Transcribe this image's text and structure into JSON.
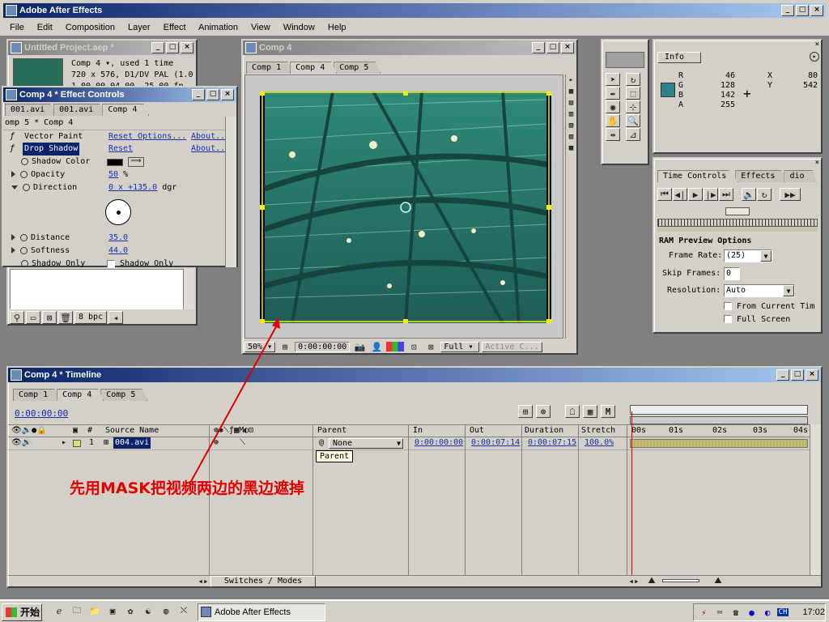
{
  "app": {
    "title": "Adobe After Effects"
  },
  "menu": [
    "File",
    "Edit",
    "Composition",
    "Layer",
    "Effect",
    "Animation",
    "View",
    "Window",
    "Help"
  ],
  "project": {
    "title": "Untitled Project.aep *",
    "info_lines": [
      "Comp 4 ▾, used 1 time",
      "720 x 576, D1/DV PAL (1.0",
      "1 00 00 04 00, 25.00 fp"
    ],
    "bpc": "8 bpc"
  },
  "effect_controls": {
    "title": "Comp 4 * Effect Controls",
    "tabs": [
      "001.avi",
      "001.avi",
      "Comp 4"
    ],
    "header": "omp 5 * Comp 4",
    "rows": [
      {
        "name": "Vector Paint",
        "reset": "Reset Options...",
        "about": "About..."
      },
      {
        "name": "Drop Shadow",
        "reset": "Reset",
        "about": "About..."
      }
    ],
    "props": {
      "shadow_color": "Shadow Color",
      "opacity": "Opacity",
      "opacity_val": "50",
      "opacity_unit": "%",
      "direction": "Direction",
      "direction_val": "0 x +135.0",
      "direction_unit": "dgr",
      "distance": "Distance",
      "distance_val": "35.0",
      "softness": "Softness",
      "softness_val": "44.0",
      "shadow_only": "Shadow Only",
      "shadow_only_box": "Shadow Only"
    }
  },
  "comp_window": {
    "title": "Comp 4",
    "tabs": [
      "Comp 1",
      "Comp 4",
      "Comp 5"
    ],
    "zoom": "50%",
    "timecode": "0:00:00:00",
    "resolution": "Full",
    "camera": "Active C..."
  },
  "info_panel": {
    "tab": "Info",
    "rgba": [
      {
        "k": "R",
        "v": "46"
      },
      {
        "k": "G",
        "v": "128"
      },
      {
        "k": "B",
        "v": "142"
      },
      {
        "k": "A",
        "v": "255"
      }
    ],
    "x_label": "X",
    "x": "80",
    "y_label": "Y",
    "y": "542",
    "swatch_color": "#2e808e"
  },
  "time_controls": {
    "tabs": [
      "Time Controls",
      "Effects",
      "dio"
    ],
    "ram_title": "RAM Preview Options",
    "frame_rate_label": "Frame Rate:",
    "frame_rate": "(25)",
    "skip_label": "Skip Frames:",
    "skip": "0",
    "res_label": "Resolution:",
    "res": "Auto",
    "from_current": "From Current Tim",
    "full_screen": "Full Screen"
  },
  "timeline": {
    "title": "Comp 4 * Timeline",
    "tabs": [
      "Comp 1",
      "Comp 4",
      "Comp 5"
    ],
    "timecode": "0:00:00:00",
    "col_source": "Source Name",
    "col_hash": "#",
    "col_parent": "Parent",
    "col_in": "In",
    "col_out": "Out",
    "col_duration": "Duration",
    "col_stretch": "Stretch",
    "ruler": [
      "00s",
      "01s",
      "02s",
      "03s",
      "04s"
    ],
    "layer": {
      "num": "1",
      "name": "004.avi",
      "parent": "None",
      "in": "0:00:00:00",
      "out": "0:00:07:14",
      "duration": "0:00:07:15",
      "stretch": "100.0%"
    },
    "tooltip": "Parent",
    "switches": "Switches / Modes"
  },
  "annotation": "先用MASK把视频两边的黑边遮掉",
  "taskbar": {
    "start": "开始",
    "task": "Adobe After Effects",
    "time": "17:02",
    "lang": "CH"
  }
}
